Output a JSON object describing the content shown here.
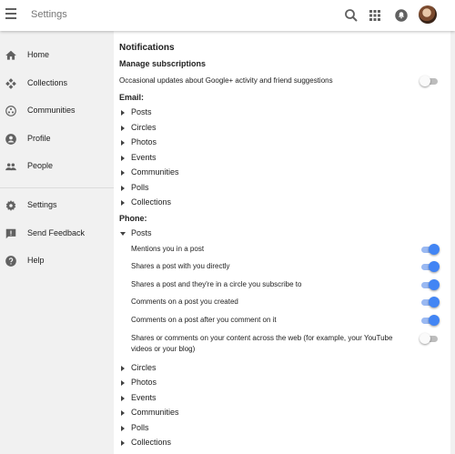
{
  "header": {
    "title": "Settings"
  },
  "sidebar": {
    "items": [
      {
        "label": "Home"
      },
      {
        "label": "Collections"
      },
      {
        "label": "Communities"
      },
      {
        "label": "Profile"
      },
      {
        "label": "People"
      },
      {
        "label": "Settings"
      },
      {
        "label": "Send Feedback"
      },
      {
        "label": "Help"
      }
    ]
  },
  "main": {
    "title": "Notifications",
    "manage_subscriptions": {
      "heading": "Manage subscriptions",
      "text": "Occasional updates about Google+ activity and friend suggestions",
      "enabled": false
    },
    "email": {
      "heading": "Email:",
      "items": [
        "Posts",
        "Circles",
        "Photos",
        "Events",
        "Communities",
        "Polls",
        "Collections"
      ]
    },
    "phone": {
      "heading": "Phone:",
      "posts_label": "Posts",
      "post_options": [
        {
          "label": "Mentions you in a post",
          "enabled": true
        },
        {
          "label": "Shares a post with you directly",
          "enabled": true
        },
        {
          "label": "Shares a post and they're in a circle you subscribe to",
          "enabled": true
        },
        {
          "label": "Comments on a post you created",
          "enabled": true
        },
        {
          "label": "Comments on a post after you comment on it",
          "enabled": true
        },
        {
          "label": "Shares or comments on your content across the web (for example, your YouTube videos or your blog)",
          "enabled": false
        }
      ],
      "items": [
        "Circles",
        "Photos",
        "Events",
        "Communities",
        "Polls",
        "Collections"
      ]
    }
  },
  "colors": {
    "accent": "#4285f4",
    "toggle_off": "#bdbdbd",
    "sidebar_bg": "#f1f1f1"
  }
}
